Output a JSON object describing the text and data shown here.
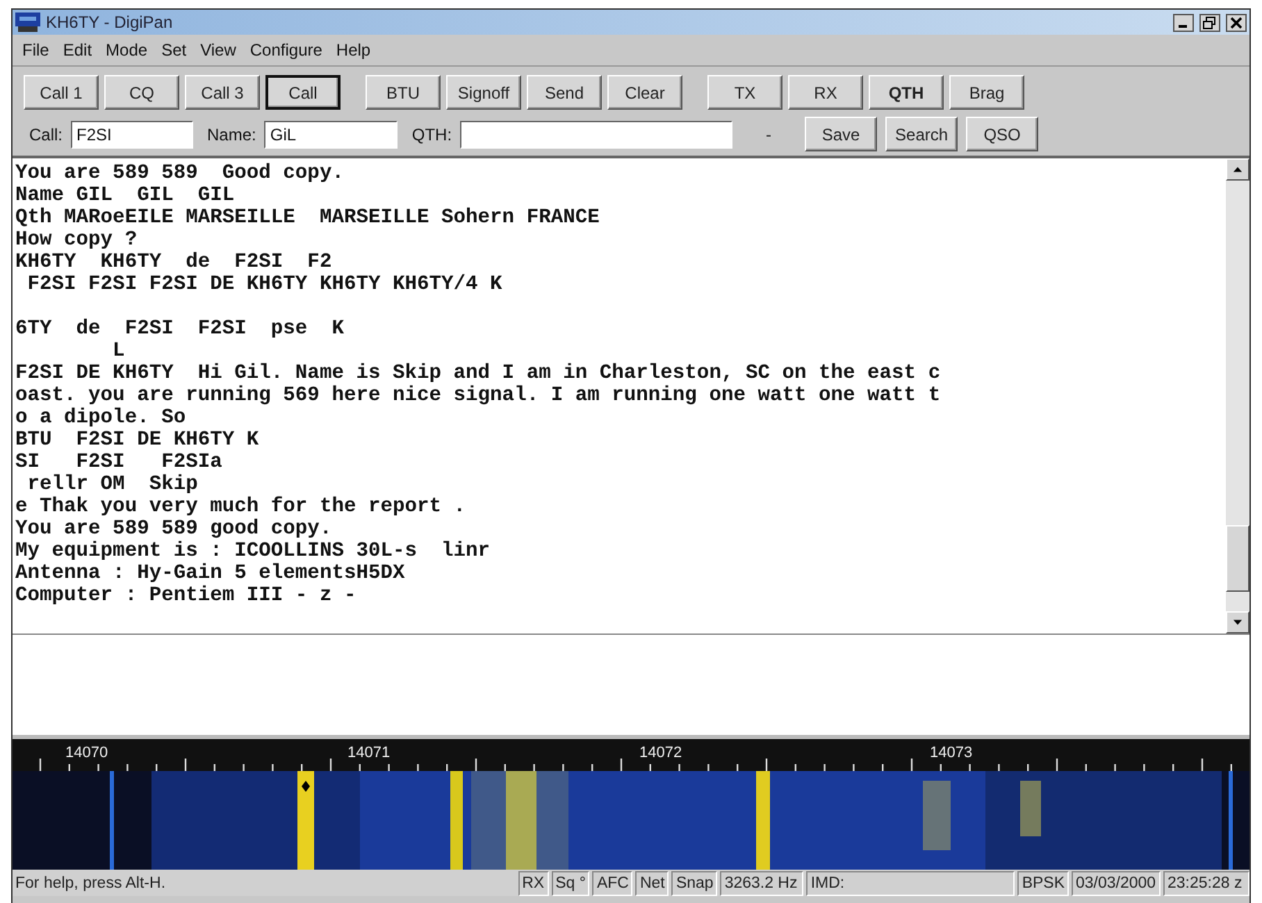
{
  "window": {
    "title": "KH6TY - DigiPan"
  },
  "menu": [
    "File",
    "Edit",
    "Mode",
    "Set",
    "View",
    "Configure",
    "Help"
  ],
  "toolbar": [
    [
      {
        "label": "Call 1",
        "focused": false,
        "bold": false
      },
      {
        "label": "CQ",
        "focused": false,
        "bold": false
      },
      {
        "label": "Call 3",
        "focused": false,
        "bold": false
      },
      {
        "label": "Call",
        "focused": true,
        "bold": false
      }
    ],
    [
      {
        "label": "BTU",
        "focused": false,
        "bold": false
      },
      {
        "label": "Signoff",
        "focused": false,
        "bold": false
      },
      {
        "label": "Send",
        "focused": false,
        "bold": false
      },
      {
        "label": "Clear",
        "focused": false,
        "bold": false
      }
    ],
    [
      {
        "label": "TX",
        "focused": false,
        "bold": false
      },
      {
        "label": "RX",
        "focused": false,
        "bold": false
      },
      {
        "label": "QTH",
        "focused": false,
        "bold": true
      },
      {
        "label": "Brag",
        "focused": false,
        "bold": false
      }
    ]
  ],
  "fields": [
    {
      "label": "Call:",
      "value": "F2SI"
    },
    {
      "label": "Name:",
      "value": "GiL"
    },
    {
      "label": "QTH:"
    }
  ],
  "field_buttons": [
    "-",
    "Save",
    "Search",
    "QSO"
  ],
  "receive_text": [
    "You are 589 589  Good copy.",
    "Name GIL  GIL  GIL",
    "Qth MARoeEILE MARSEILLE  MARSEILLE Sohern FRANCE",
    "How copy ?",
    "KH6TY  KH6TY  de  F2SI  F2",
    " F2SI F2SI F2SI DE KH6TY KH6TY KH6TY/4 K",
    "6TY  de  F2SI  F2SI  pse  K",
    "        L",
    "F2SI DE KH6TY  Hi Gil. Name is Skip and I am in Charleston, SC on the east c",
    "oast. you are running 569 here nice signal. I am running one watt one watt t",
    "o a dipole. So",
    "BTU  F2SI DE KH6TY K",
    "SI   F2SI   F2SIa",
    " rellr OM  Skip",
    "e Thak you very much for the report .",
    "You are 589 589 good copy.",
    "My equipment is : ICOOLLINS 30L-s  linr",
    "Antenna : Hy-Gain 5 elementsH5DX",
    "Computer : Pentiem III - z -"
  ],
  "waterfall": {
    "scale": [
      "14070",
      "14071",
      "14072",
      "14073"
    ]
  },
  "status_bar": {
    "help": "For help, press Alt-H.",
    "panels": [
      "RX",
      "Sq °",
      "AFC",
      "Net",
      "Snap",
      "3263.2 Hz",
      "IMD:",
      "BPSK",
      "03/03/2000",
      "23:25:28 z"
    ]
  }
}
